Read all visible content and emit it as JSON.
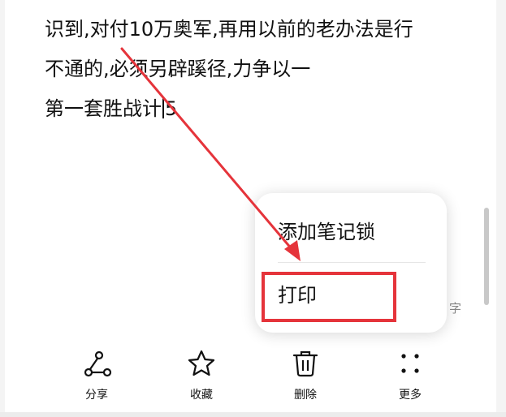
{
  "note": {
    "line1": "识到,对付10万奥军,再用以前的老办法是行",
    "line2": "不通的,必须另辟蹊径,力争以一",
    "line3_before_caret": "第一套胜战计",
    "line3_after_caret": "5"
  },
  "char_count_suffix": "字",
  "popup_menu": {
    "items": [
      {
        "label": "添加笔记锁"
      },
      {
        "label": "打印"
      }
    ]
  },
  "toolbar": {
    "items": [
      {
        "label": "分享",
        "icon": "share-icon"
      },
      {
        "label": "收藏",
        "icon": "star-icon"
      },
      {
        "label": "删除",
        "icon": "trash-icon"
      },
      {
        "label": "更多",
        "icon": "more-icon"
      }
    ]
  },
  "annotation": {
    "arrow_color": "#e5343b",
    "highlight_color": "#e5343b"
  }
}
